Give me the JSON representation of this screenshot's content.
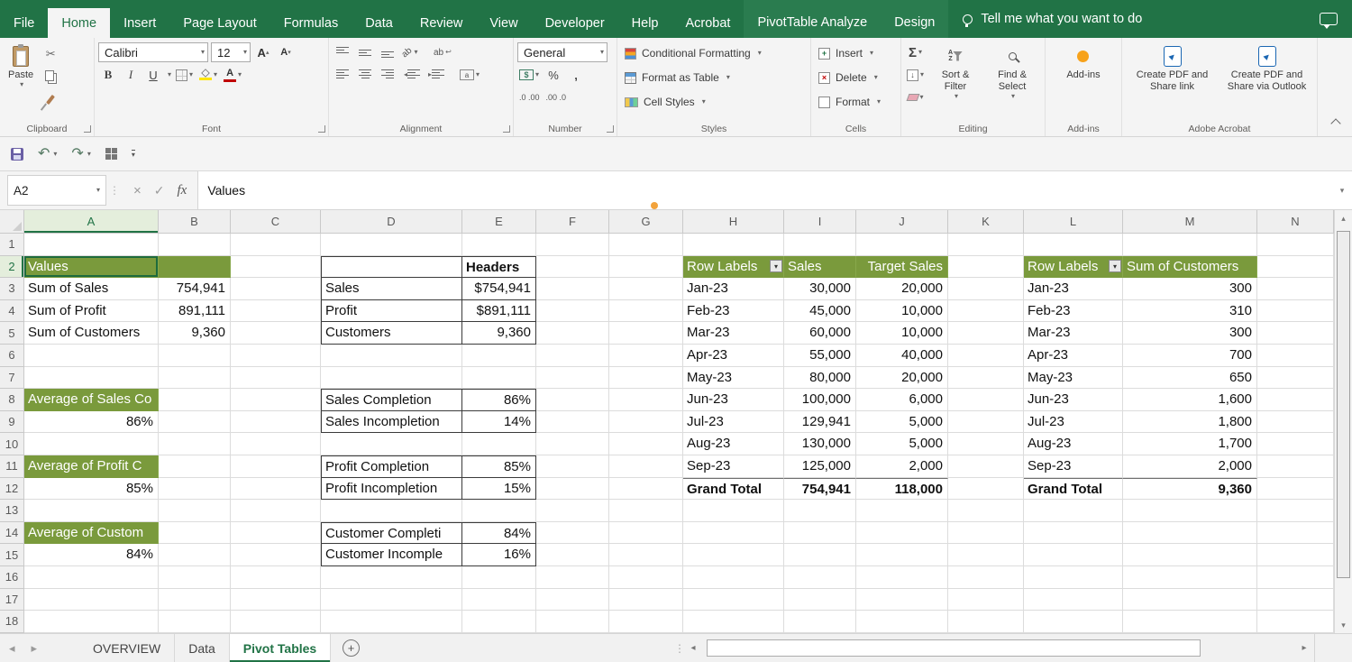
{
  "colors": {
    "ribbon_green": "#217346",
    "contextual_tab_green": "#2A7C4F",
    "pivot_header_green": "#7A9A3C",
    "active_sheet_text": "#217346",
    "fill_color_yellow": "#FFE600",
    "font_color_red": "#C00000",
    "addins_orange": "#F7A21B",
    "acrobat_blue": "#1B67B3"
  },
  "ribbon": {
    "tabs": [
      "File",
      "Home",
      "Insert",
      "Page Layout",
      "Formulas",
      "Data",
      "Review",
      "View",
      "Developer",
      "Help",
      "Acrobat",
      "PivotTable Analyze",
      "Design"
    ],
    "active_tab": "Home",
    "contextual_start_index": 11,
    "tell_me": "Tell me what you want to do",
    "clipboard": {
      "label": "Clipboard",
      "paste": "Paste"
    },
    "font": {
      "label": "Font",
      "font_name": "Calibri",
      "font_size": "12",
      "bold": "B",
      "italic": "I",
      "underline": "U",
      "grow_font": "A",
      "shrink_font": "A",
      "font_color_letter": "A"
    },
    "alignment": {
      "label": "Alignment",
      "orientation_text": "ab",
      "wrap_text": "ab"
    },
    "number": {
      "label": "Number",
      "format": "General",
      "accounting": "$",
      "percent": "%",
      "comma": ",",
      "increase_decimal": ".0 .00",
      "decrease_decimal": ".00 .0"
    },
    "styles": {
      "label": "Styles",
      "items": [
        "Conditional Formatting",
        "Format as Table",
        "Cell Styles"
      ]
    },
    "cells": {
      "label": "Cells",
      "items": [
        "Insert",
        "Delete",
        "Format"
      ]
    },
    "editing": {
      "label": "Editing",
      "autosum": "Σ",
      "sort_filter": "Sort & Filter",
      "find_select": "Find & Select"
    },
    "addins": {
      "label": "Add-ins",
      "button": "Add-ins"
    },
    "acrobat": {
      "label": "Adobe Acrobat",
      "create_share_link": "Create PDF and Share link",
      "create_share_outlook": "Create PDF and Share via Outlook"
    }
  },
  "formula_bar": {
    "name_box": "A2",
    "fx_label": "fx",
    "content": "Values"
  },
  "grid": {
    "active_cell": "A2",
    "column_letters": [
      "A",
      "B",
      "C",
      "D",
      "E",
      "F",
      "G",
      "H",
      "I",
      "J",
      "K",
      "L",
      "M",
      "N"
    ],
    "visible_rows": 18,
    "cells": [
      {
        "c": "A",
        "r": 2,
        "t": "Values",
        "f": 1
      },
      {
        "c": "B",
        "r": 2,
        "t": "",
        "f": 1
      },
      {
        "c": "A",
        "r": 3,
        "t": "Sum of Sales"
      },
      {
        "c": "B",
        "r": 3,
        "t": "754,941",
        "a": "r"
      },
      {
        "c": "A",
        "r": 4,
        "t": "Sum of Profit"
      },
      {
        "c": "B",
        "r": 4,
        "t": "891,111",
        "a": "r"
      },
      {
        "c": "A",
        "r": 5,
        "t": "Sum of Customers"
      },
      {
        "c": "B",
        "r": 5,
        "t": "9,360",
        "a": "r"
      },
      {
        "c": "A",
        "r": 8,
        "t": "Average of Sales Co",
        "f": 1
      },
      {
        "c": "A",
        "r": 9,
        "t": "86%",
        "a": "r"
      },
      {
        "c": "A",
        "r": 11,
        "t": "Average of Profit C",
        "f": 1
      },
      {
        "c": "A",
        "r": 12,
        "t": "85%",
        "a": "r"
      },
      {
        "c": "A",
        "r": 14,
        "t": "Average of Custom",
        "f": 1
      },
      {
        "c": "A",
        "r": 15,
        "t": "84%",
        "a": "r"
      },
      {
        "c": "D",
        "r": 2,
        "t": "",
        "x": 1
      },
      {
        "c": "E",
        "r": 2,
        "t": "Headers",
        "b": 1,
        "x": 1
      },
      {
        "c": "D",
        "r": 3,
        "t": "Sales",
        "x": 1
      },
      {
        "c": "E",
        "r": 3,
        "t": "$754,941",
        "a": "r",
        "x": 1
      },
      {
        "c": "D",
        "r": 4,
        "t": "Profit",
        "x": 1
      },
      {
        "c": "E",
        "r": 4,
        "t": "$891,111",
        "a": "r",
        "x": 1
      },
      {
        "c": "D",
        "r": 5,
        "t": "Customers",
        "x": 1
      },
      {
        "c": "E",
        "r": 5,
        "t": "9,360",
        "a": "r",
        "x": 1
      },
      {
        "c": "D",
        "r": 8,
        "t": "Sales Completion",
        "x": 1
      },
      {
        "c": "E",
        "r": 8,
        "t": "86%",
        "a": "r",
        "x": 1
      },
      {
        "c": "D",
        "r": 9,
        "t": "Sales Incompletion",
        "x": 1
      },
      {
        "c": "E",
        "r": 9,
        "t": "14%",
        "a": "r",
        "x": 1
      },
      {
        "c": "D",
        "r": 11,
        "t": "Profit Completion",
        "x": 1
      },
      {
        "c": "E",
        "r": 11,
        "t": "85%",
        "a": "r",
        "x": 1
      },
      {
        "c": "D",
        "r": 12,
        "t": "Profit Incompletion",
        "x": 1
      },
      {
        "c": "E",
        "r": 12,
        "t": "15%",
        "a": "r",
        "x": 1
      },
      {
        "c": "D",
        "r": 14,
        "t": "Customer Completi",
        "x": 1
      },
      {
        "c": "E",
        "r": 14,
        "t": "84%",
        "a": "r",
        "x": 1
      },
      {
        "c": "D",
        "r": 15,
        "t": "Customer Incomple",
        "x": 1
      },
      {
        "c": "E",
        "r": 15,
        "t": "16%",
        "a": "r",
        "x": 1
      },
      {
        "c": "H",
        "r": 2,
        "t": "Row Labels",
        "f": 1,
        "fl": 1
      },
      {
        "c": "I",
        "r": 2,
        "t": "Sales",
        "f": 1
      },
      {
        "c": "J",
        "r": 2,
        "t": "Target Sales",
        "f": 1,
        "a": "r"
      },
      {
        "c": "H",
        "r": 3,
        "t": "Jan-23"
      },
      {
        "c": "I",
        "r": 3,
        "t": "30,000",
        "a": "r"
      },
      {
        "c": "J",
        "r": 3,
        "t": "20,000",
        "a": "r"
      },
      {
        "c": "H",
        "r": 4,
        "t": "Feb-23"
      },
      {
        "c": "I",
        "r": 4,
        "t": "45,000",
        "a": "r"
      },
      {
        "c": "J",
        "r": 4,
        "t": "10,000",
        "a": "r"
      },
      {
        "c": "H",
        "r": 5,
        "t": "Mar-23"
      },
      {
        "c": "I",
        "r": 5,
        "t": "60,000",
        "a": "r"
      },
      {
        "c": "J",
        "r": 5,
        "t": "10,000",
        "a": "r"
      },
      {
        "c": "H",
        "r": 6,
        "t": "Apr-23"
      },
      {
        "c": "I",
        "r": 6,
        "t": "55,000",
        "a": "r"
      },
      {
        "c": "J",
        "r": 6,
        "t": "40,000",
        "a": "r"
      },
      {
        "c": "H",
        "r": 7,
        "t": "May-23"
      },
      {
        "c": "I",
        "r": 7,
        "t": "80,000",
        "a": "r"
      },
      {
        "c": "J",
        "r": 7,
        "t": "20,000",
        "a": "r"
      },
      {
        "c": "H",
        "r": 8,
        "t": "Jun-23"
      },
      {
        "c": "I",
        "r": 8,
        "t": "100,000",
        "a": "r"
      },
      {
        "c": "J",
        "r": 8,
        "t": "6,000",
        "a": "r"
      },
      {
        "c": "H",
        "r": 9,
        "t": "Jul-23"
      },
      {
        "c": "I",
        "r": 9,
        "t": "129,941",
        "a": "r"
      },
      {
        "c": "J",
        "r": 9,
        "t": "5,000",
        "a": "r"
      },
      {
        "c": "H",
        "r": 10,
        "t": "Aug-23"
      },
      {
        "c": "I",
        "r": 10,
        "t": "130,000",
        "a": "r"
      },
      {
        "c": "J",
        "r": 10,
        "t": "5,000",
        "a": "r"
      },
      {
        "c": "H",
        "r": 11,
        "t": "Sep-23"
      },
      {
        "c": "I",
        "r": 11,
        "t": "125,000",
        "a": "r"
      },
      {
        "c": "J",
        "r": 11,
        "t": "2,000",
        "a": "r"
      },
      {
        "c": "H",
        "r": 12,
        "t": "Grand Total",
        "b": 1,
        "tl": 1
      },
      {
        "c": "I",
        "r": 12,
        "t": "754,941",
        "b": 1,
        "a": "r",
        "tl": 1
      },
      {
        "c": "J",
        "r": 12,
        "t": "118,000",
        "b": 1,
        "a": "r",
        "tl": 1
      },
      {
        "c": "L",
        "r": 2,
        "t": "Row Labels",
        "f": 1,
        "fl": 1
      },
      {
        "c": "M",
        "r": 2,
        "t": "Sum of Customers",
        "f": 1
      },
      {
        "c": "L",
        "r": 3,
        "t": "Jan-23"
      },
      {
        "c": "M",
        "r": 3,
        "t": "300",
        "a": "r"
      },
      {
        "c": "L",
        "r": 4,
        "t": "Feb-23"
      },
      {
        "c": "M",
        "r": 4,
        "t": "310",
        "a": "r"
      },
      {
        "c": "L",
        "r": 5,
        "t": "Mar-23"
      },
      {
        "c": "M",
        "r": 5,
        "t": "300",
        "a": "r"
      },
      {
        "c": "L",
        "r": 6,
        "t": "Apr-23"
      },
      {
        "c": "M",
        "r": 6,
        "t": "700",
        "a": "r"
      },
      {
        "c": "L",
        "r": 7,
        "t": "May-23"
      },
      {
        "c": "M",
        "r": 7,
        "t": "650",
        "a": "r"
      },
      {
        "c": "L",
        "r": 8,
        "t": "Jun-23"
      },
      {
        "c": "M",
        "r": 8,
        "t": "1,600",
        "a": "r"
      },
      {
        "c": "L",
        "r": 9,
        "t": "Jul-23"
      },
      {
        "c": "M",
        "r": 9,
        "t": "1,800",
        "a": "r"
      },
      {
        "c": "L",
        "r": 10,
        "t": "Aug-23"
      },
      {
        "c": "M",
        "r": 10,
        "t": "1,700",
        "a": "r"
      },
      {
        "c": "L",
        "r": 11,
        "t": "Sep-23"
      },
      {
        "c": "M",
        "r": 11,
        "t": "2,000",
        "a": "r"
      },
      {
        "c": "L",
        "r": 12,
        "t": "Grand Total",
        "b": 1,
        "tl": 1
      },
      {
        "c": "M",
        "r": 12,
        "t": "9,360",
        "b": 1,
        "a": "r",
        "tl": 1
      }
    ]
  },
  "sheet_bar": {
    "tabs": [
      "OVERVIEW",
      "Data",
      "Pivot Tables"
    ],
    "active_tab": "Pivot Tables"
  }
}
